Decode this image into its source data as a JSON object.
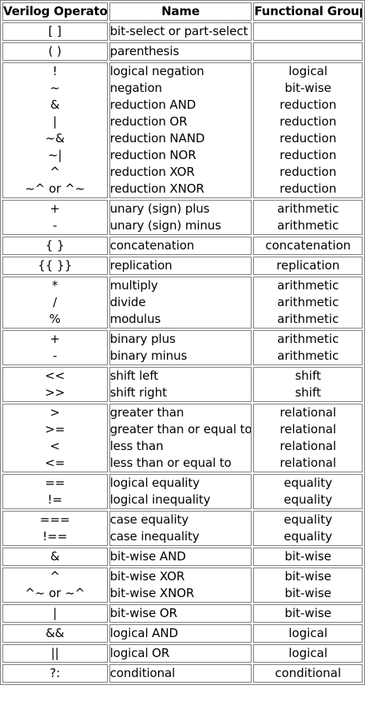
{
  "headers": {
    "operator": "Verilog Operator",
    "name": "Name",
    "group": "Functional Group"
  },
  "rows": [
    {
      "ops": [
        "[ ]"
      ],
      "names": [
        "bit-select or part-select"
      ],
      "groups": []
    },
    {
      "ops": [
        "( )"
      ],
      "names": [
        "parenthesis"
      ],
      "groups": []
    },
    {
      "ops": [
        "!",
        "~",
        "&",
        "|",
        "~&",
        "~|",
        "^",
        "~^ or ^~"
      ],
      "names": [
        "logical negation",
        "negation",
        "reduction AND",
        "reduction OR",
        "reduction NAND",
        "reduction NOR",
        "reduction XOR",
        "reduction XNOR"
      ],
      "groups": [
        "logical",
        "bit-wise",
        "reduction",
        "reduction",
        "reduction",
        "reduction",
        "reduction",
        "reduction"
      ]
    },
    {
      "ops": [
        "+",
        "-"
      ],
      "names": [
        "unary (sign) plus",
        "unary (sign) minus"
      ],
      "groups": [
        "arithmetic",
        "arithmetic"
      ]
    },
    {
      "ops": [
        "{ }"
      ],
      "names": [
        "concatenation"
      ],
      "groups": [
        "concatenation"
      ]
    },
    {
      "ops": [
        "{{ }}"
      ],
      "names": [
        "replication"
      ],
      "groups": [
        "replication"
      ]
    },
    {
      "ops": [
        "*",
        "/",
        "%"
      ],
      "names": [
        "multiply",
        "divide",
        "modulus"
      ],
      "groups": [
        "arithmetic",
        "arithmetic",
        "arithmetic"
      ]
    },
    {
      "ops": [
        "+",
        "-"
      ],
      "names": [
        "binary plus",
        "binary minus"
      ],
      "groups": [
        "arithmetic",
        "arithmetic"
      ]
    },
    {
      "ops": [
        "<<",
        ">>"
      ],
      "names": [
        "shift left",
        "shift right"
      ],
      "groups": [
        "shift",
        "shift"
      ]
    },
    {
      "ops": [
        ">",
        ">=",
        "<",
        "<="
      ],
      "names": [
        "greater than",
        "greater than or equal to",
        "less than",
        "less than or equal to"
      ],
      "groups": [
        "relational",
        "relational",
        "relational",
        "relational"
      ]
    },
    {
      "ops": [
        "==",
        "!="
      ],
      "names": [
        "logical equality",
        "logical inequality"
      ],
      "groups": [
        "equality",
        "equality"
      ]
    },
    {
      "ops": [
        "===",
        "!=="
      ],
      "names": [
        "case equality",
        "case inequality"
      ],
      "groups": [
        "equality",
        "equality"
      ]
    },
    {
      "ops": [
        "&"
      ],
      "names": [
        "bit-wise AND"
      ],
      "groups": [
        "bit-wise"
      ]
    },
    {
      "ops": [
        "^",
        "^~ or ~^"
      ],
      "names": [
        "bit-wise XOR",
        "bit-wise XNOR"
      ],
      "groups": [
        "bit-wise",
        "bit-wise"
      ]
    },
    {
      "ops": [
        "|"
      ],
      "names": [
        "bit-wise OR"
      ],
      "groups": [
        "bit-wise"
      ]
    },
    {
      "ops": [
        "&&"
      ],
      "names": [
        "logical AND"
      ],
      "groups": [
        "logical"
      ]
    },
    {
      "ops": [
        "||"
      ],
      "names": [
        "logical OR"
      ],
      "groups": [
        "logical"
      ]
    },
    {
      "ops": [
        "?:"
      ],
      "names": [
        "conditional"
      ],
      "groups": [
        "conditional"
      ]
    }
  ]
}
